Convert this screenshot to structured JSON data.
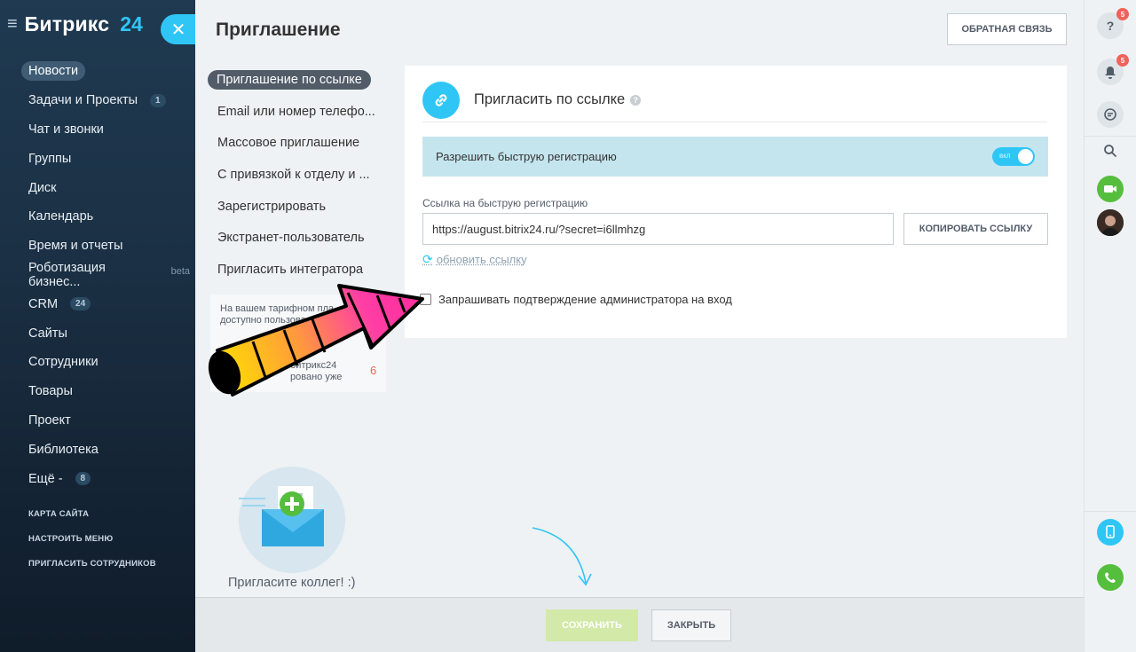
{
  "leftnav": {
    "brand": "Битрикс",
    "brand_num": "24",
    "items": [
      {
        "label": "Новости",
        "active": true
      },
      {
        "label": "Задачи и Проекты",
        "count": "1"
      },
      {
        "label": "Чат и звонки"
      },
      {
        "label": "Группы"
      },
      {
        "label": "Диск"
      },
      {
        "label": "Календарь"
      },
      {
        "label": "Время и отчеты"
      },
      {
        "label": "Роботизация бизнес...",
        "beta": "beta"
      },
      {
        "label": "CRM",
        "count": "24"
      },
      {
        "label": "Сайты"
      },
      {
        "label": "Сотрудники"
      },
      {
        "label": "Товары"
      },
      {
        "label": "Проект"
      },
      {
        "label": "Библиотека"
      },
      {
        "label": "Ещё -",
        "count": "8"
      }
    ],
    "small_links": [
      "КАРТА САЙТА",
      "НАСТРОИТЬ МЕНЮ",
      "ПРИГЛАСИТЬ СОТРУДНИКОВ"
    ]
  },
  "panel": {
    "title": "Приглашение",
    "feedback_button": "ОБРАТНАЯ СВЯЗЬ",
    "submenu": [
      {
        "label": "Приглашение по ссылке",
        "active": true
      },
      {
        "label": "Email или номер телефо..."
      },
      {
        "label": "Массовое приглашение"
      },
      {
        "label": "С привязкой к отделу и ..."
      },
      {
        "label": "Зарегистрировать"
      },
      {
        "label": "Экстранет-пользователь"
      },
      {
        "label": "Пригласить интегратора"
      }
    ],
    "tariff": {
      "line1": "На вашем тарифном пла",
      "line2": "доступно пользова",
      "line3": "битрикс24",
      "line4": "ровано уже",
      "count": "6"
    },
    "card": {
      "title": "Пригласить по ссылке",
      "help": "?",
      "quick_reg_label": "Разрешить быструю регистрацию",
      "toggle_text": "вкл",
      "link_label": "Ссылка на быструю регистрацию",
      "link_value": "https://august.bitrix24.ru/?secret=i6llmhzg",
      "copy_button": "КОПИРОВАТЬ ССЫЛКУ",
      "refresh_link": "обновить ссылку",
      "admin_checkbox": "Запрашивать подтверждение администратора на вход"
    },
    "invite_text": "Пригласите коллег! :)",
    "footer": {
      "save": "СОХРАНИТЬ",
      "close": "ЗАКРЫТЬ"
    }
  },
  "rightbar": {
    "help_badge": "5",
    "notif_badge": "5"
  },
  "colors": {
    "accent": "#2fc6f6",
    "nav_bg": "#1b3044",
    "save_disabled": "#d2e9a8",
    "badge": "#f0625a"
  }
}
